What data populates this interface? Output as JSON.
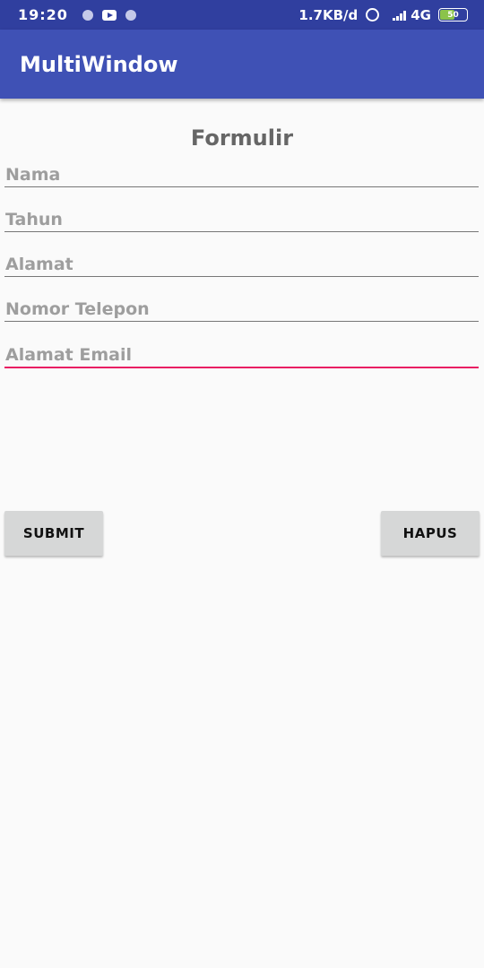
{
  "status_bar": {
    "time": "19:20",
    "net_speed": "1.7KB/d",
    "net_type": "4G",
    "battery": "50"
  },
  "app_bar": {
    "title": "MultiWindow"
  },
  "form": {
    "title": "Formulir",
    "fields": [
      {
        "placeholder": "Nama"
      },
      {
        "placeholder": "Tahun"
      },
      {
        "placeholder": "Alamat"
      },
      {
        "placeholder": "Nomor Telepon"
      },
      {
        "placeholder": "Alamat Email"
      }
    ],
    "submit_label": "SUBMIT",
    "reset_label": "HAPUS"
  },
  "colors": {
    "status_bar": "#303f9f",
    "app_bar": "#3f51b5",
    "accent": "#e91e63",
    "button": "#d6d7d7"
  }
}
